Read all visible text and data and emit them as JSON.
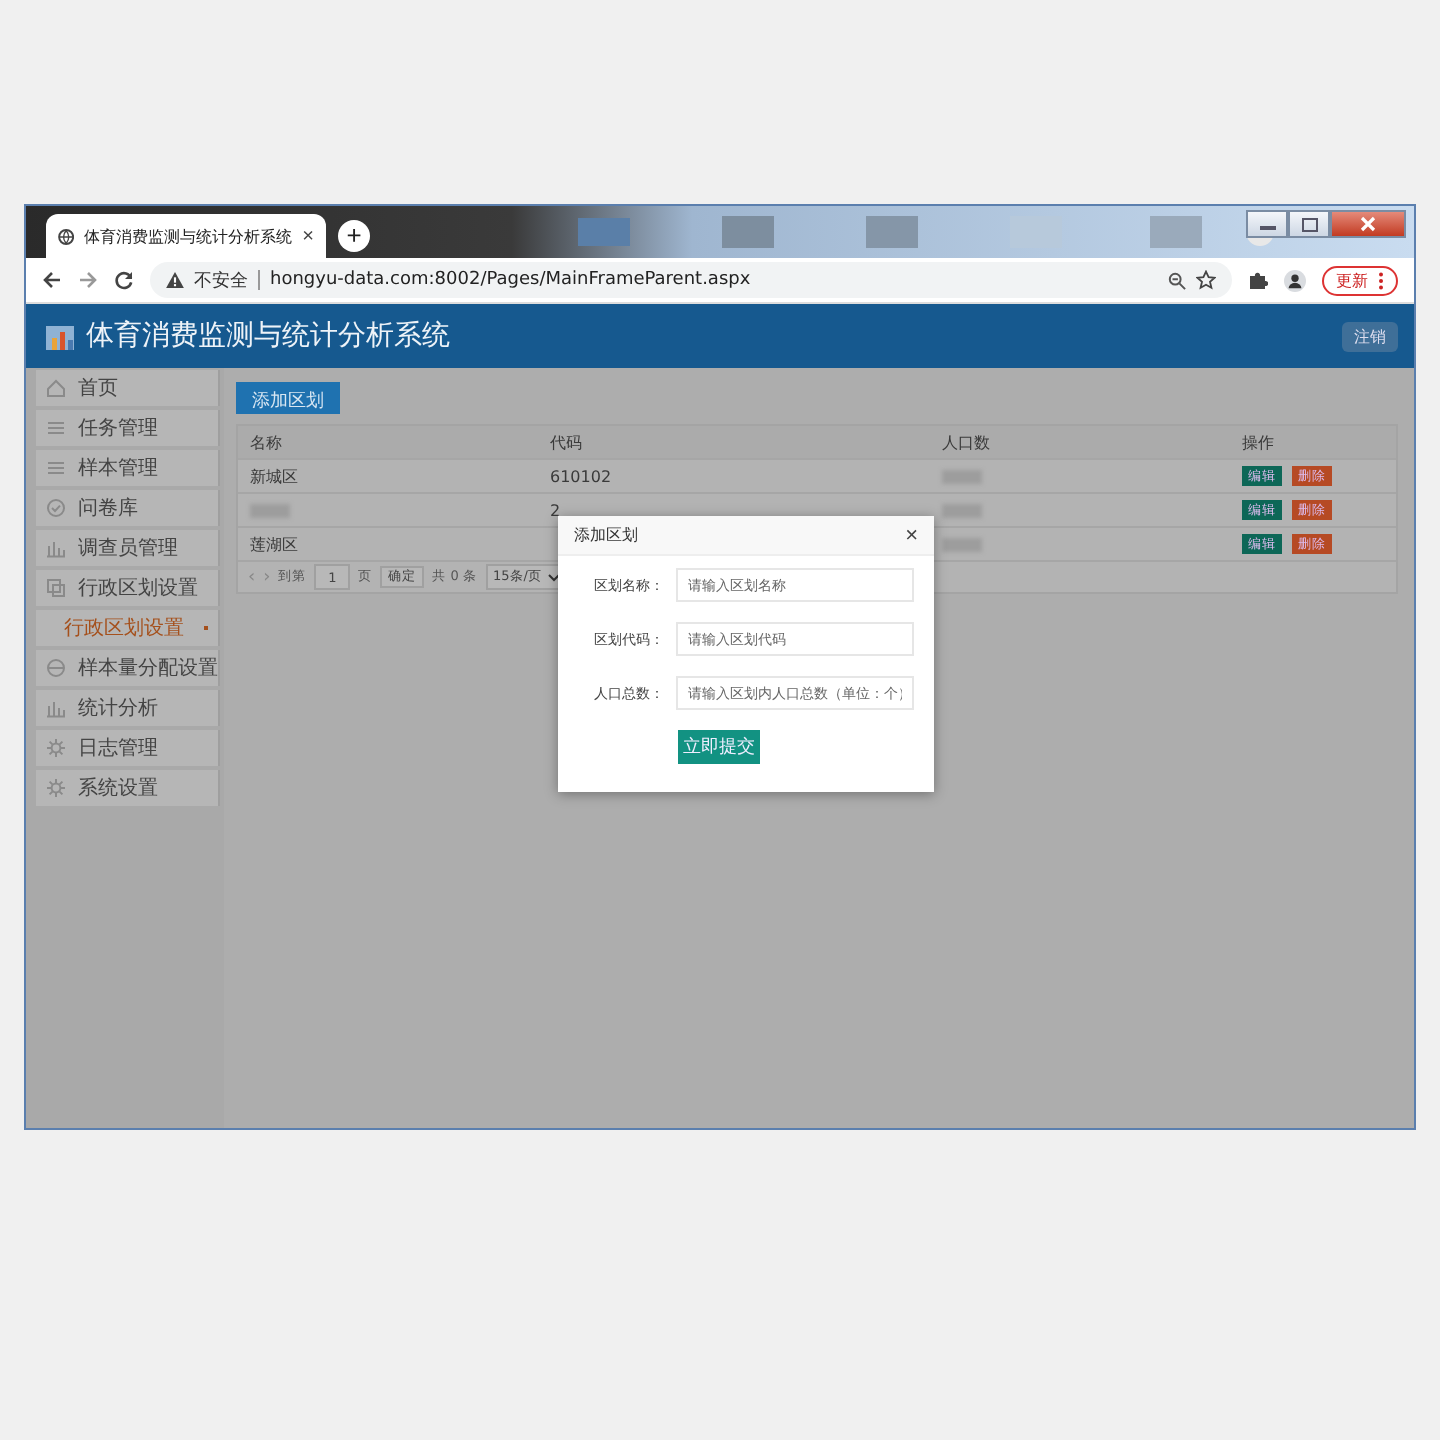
{
  "browser": {
    "tab_title": "体育消费监测与统计分析系统",
    "tab_close": "×",
    "new_tab": "+",
    "security": "不安全",
    "url": "hongyu-data.com:8002/Pages/MainFrameParent.aspx",
    "update_button": "更新"
  },
  "header": {
    "title": "体育消费监测与统计分析系统",
    "logout": "注销"
  },
  "sidebar": {
    "items": [
      {
        "label": "首页",
        "selected": false
      },
      {
        "label": "任务管理",
        "selected": false
      },
      {
        "label": "样本管理",
        "selected": false
      },
      {
        "label": "问卷库",
        "selected": false
      },
      {
        "label": "调查员管理",
        "selected": false
      },
      {
        "label": "行政区划设置",
        "selected": false,
        "children": [
          {
            "label": "行政区划设置",
            "selected": true
          }
        ]
      },
      {
        "label": "样本量分配设置",
        "selected": false
      },
      {
        "label": "统计分析",
        "selected": false
      },
      {
        "label": "日志管理",
        "selected": false
      },
      {
        "label": "系统设置",
        "selected": false
      }
    ]
  },
  "toolbar": {
    "add_button": "添加区划"
  },
  "table": {
    "columns": [
      "名称",
      "代码",
      "人口数",
      "操作"
    ],
    "rows": [
      {
        "cells": [
          {
            "kind": "text",
            "text": "新城区"
          },
          {
            "kind": "text",
            "text": "610102"
          },
          {
            "kind": "redacted"
          }
        ],
        "actions": [
          {
            "label": "编辑",
            "kind": "edit"
          },
          {
            "label": "删除",
            "kind": "delete"
          }
        ]
      },
      {
        "cells": [
          {
            "kind": "redacted"
          },
          {
            "kind": "text",
            "text": "2"
          },
          {
            "kind": "redacted"
          }
        ],
        "actions": [
          {
            "label": "编辑",
            "kind": "edit"
          },
          {
            "label": "删除",
            "kind": "delete"
          }
        ]
      },
      {
        "cells": [
          {
            "kind": "text",
            "text": "莲湖区"
          },
          null,
          {
            "kind": "redacted"
          }
        ],
        "actions": [
          {
            "label": "编辑",
            "kind": "edit"
          },
          {
            "label": "删除",
            "kind": "delete"
          }
        ]
      }
    ]
  },
  "pagination": {
    "prev": "‹",
    "next": "›",
    "goto_label": "到第",
    "page": "1",
    "page_unit": "页",
    "confirm": "确定",
    "total": "共 0 条",
    "page_size": "15条/页"
  },
  "dialog": {
    "title": "添加区划",
    "close": "×",
    "fields": [
      {
        "label": "区划名称：",
        "placeholder": "请输入区划名称"
      },
      {
        "label": "区划代码：",
        "placeholder": "请输入区划代码"
      },
      {
        "label": "人口总数：",
        "placeholder": "请输入区划内人口总数（单位：个）"
      }
    ],
    "submit": "立即提交"
  }
}
